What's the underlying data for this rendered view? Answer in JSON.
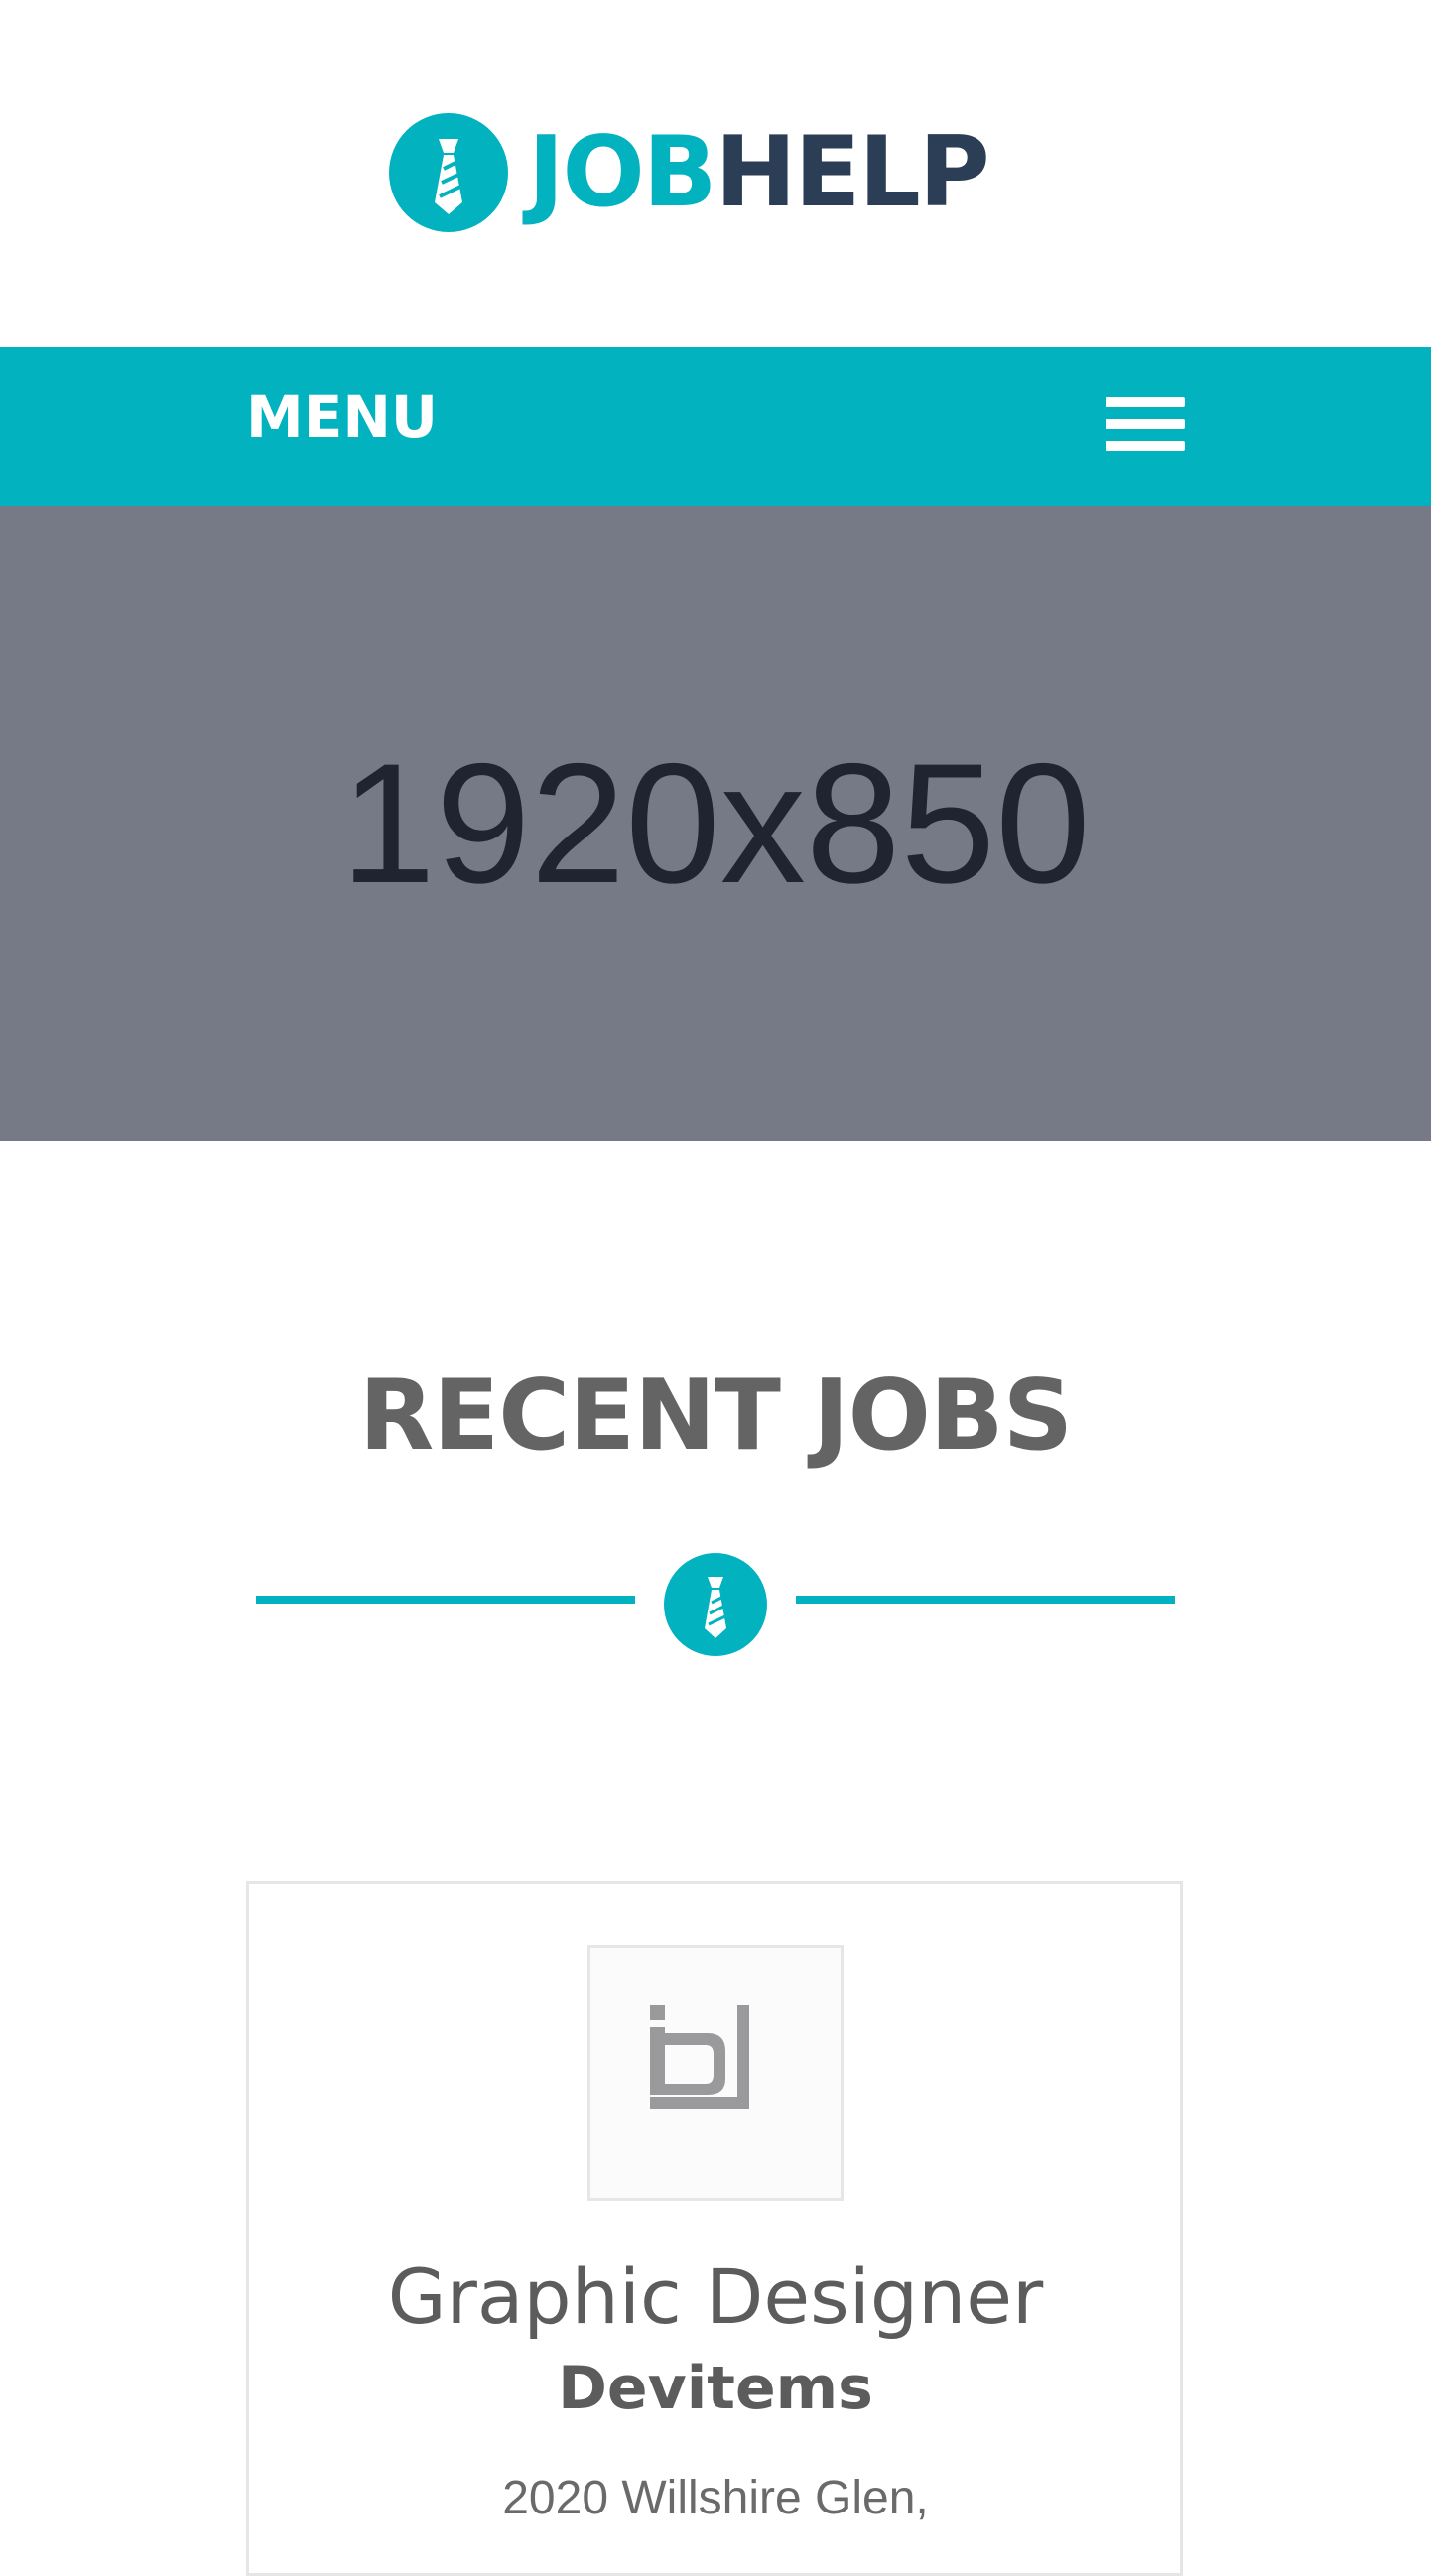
{
  "header": {
    "logo_part1": "JOB",
    "logo_part2": "HELP",
    "logo_icon": "tie-icon"
  },
  "nav": {
    "menu_label": "MENU",
    "menu_icon": "hamburger-icon"
  },
  "hero": {
    "placeholder_text": "1920x850"
  },
  "recent_jobs": {
    "title": "RECENT JOBS",
    "divider_icon": "tie-icon",
    "jobs": [
      {
        "logo_icon": "company-logo-devitems",
        "title": "Graphic Designer",
        "company": "Devitems",
        "address": "2020 Willshire Glen,"
      }
    ]
  },
  "colors": {
    "accent": "#03b2bf",
    "dark": "#2c3e55",
    "hero_bg": "#767a86",
    "heading": "#646464"
  }
}
